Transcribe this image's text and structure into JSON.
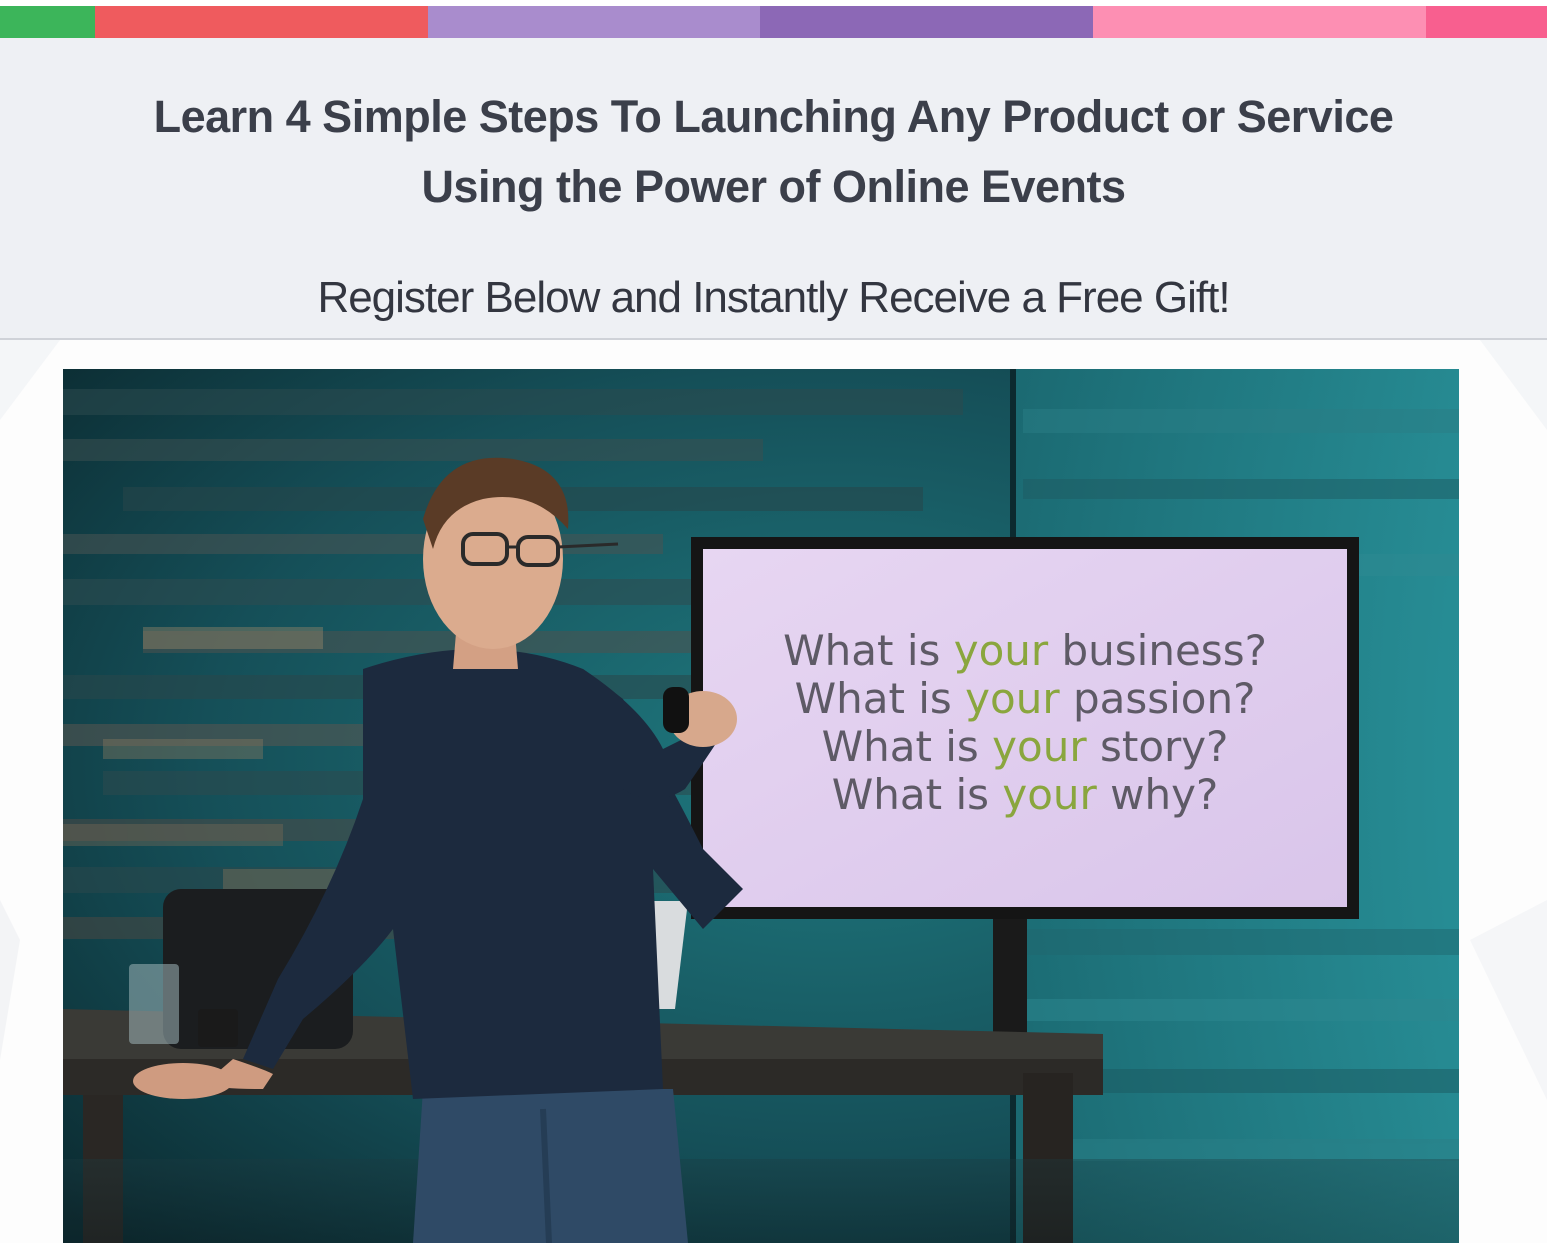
{
  "stripe": {
    "colors": [
      "#3cb55a",
      "#ef5b5e",
      "#a98ccd",
      "#8c68b6",
      "#fd8fb3",
      "#f85f8f"
    ]
  },
  "header": {
    "headline_line1": "Learn 4 Simple Steps To Launching Any Product or Service",
    "headline_line2": "Using the Power of Online Events",
    "subheadline": "Register Below and Instantly Receive a Free Gift!"
  },
  "video": {
    "screen_lines": [
      {
        "before": "What is ",
        "highlight": "your",
        "after": " business?"
      },
      {
        "before": "What is ",
        "highlight": "your",
        "after": " passion?"
      },
      {
        "before": "What is ",
        "highlight": "your",
        "after": " story?"
      },
      {
        "before": "What is ",
        "highlight": "your",
        "after": " why?"
      }
    ],
    "highlight_color": "#8aa63e"
  }
}
